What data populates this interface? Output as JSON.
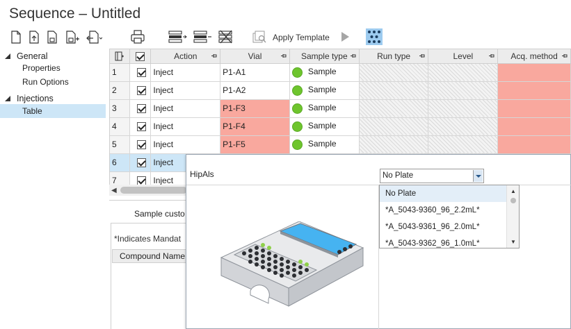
{
  "window": {
    "title": "Sequence – Untitled"
  },
  "toolbar": {
    "apply_template_label": "Apply Template",
    "icons": [
      "new-icon",
      "import-icon",
      "save-icon",
      "save-as-icon",
      "export-icon",
      "print-icon",
      "insert-row-icon",
      "delete-row-icon",
      "clear-rows-icon",
      "template-icon",
      "run-icon",
      "plate-layout-icon"
    ]
  },
  "sidebar": {
    "groups": [
      {
        "label": "General",
        "items": [
          "Properties",
          "Run Options"
        ]
      },
      {
        "label": "Injections",
        "items": [
          "Table"
        ]
      }
    ],
    "selected": "Table"
  },
  "grid": {
    "columns": [
      "Action",
      "Vial",
      "Sample type",
      "Run type",
      "Level",
      "Acq. method"
    ],
    "rows": [
      {
        "num": "1",
        "action": "Inject",
        "vial": "P1-A1",
        "vial_error": false,
        "sample_type": "Sample"
      },
      {
        "num": "2",
        "action": "Inject",
        "vial": "P1-A2",
        "vial_error": false,
        "sample_type": "Sample"
      },
      {
        "num": "3",
        "action": "Inject",
        "vial": "P1-F3",
        "vial_error": true,
        "sample_type": "Sample"
      },
      {
        "num": "4",
        "action": "Inject",
        "vial": "P1-F4",
        "vial_error": true,
        "sample_type": "Sample"
      },
      {
        "num": "5",
        "action": "Inject",
        "vial": "P1-F5",
        "vial_error": true,
        "sample_type": "Sample"
      },
      {
        "num": "6",
        "action": "Inject",
        "vial": "",
        "vial_error": false,
        "sample_type": ""
      },
      {
        "num": "7",
        "action": "Inject",
        "vial": "",
        "vial_error": false,
        "sample_type": ""
      }
    ],
    "error_color": "#f9a89e",
    "selected_row": "6"
  },
  "lower_panel": {
    "tab_label": "Sample custo",
    "mandatory_note": "*Indicates Mandat",
    "compound_header": "Compound Name"
  },
  "popup": {
    "device_label": "HipAls",
    "plate_select": {
      "value": "No Plate"
    },
    "plate_options": [
      "No Plate",
      "*A_5043-9360_96_2.2mL*",
      "*A_5043-9361_96_2.0mL*",
      "*A_5043-9362_96_1.0mL*"
    ]
  }
}
